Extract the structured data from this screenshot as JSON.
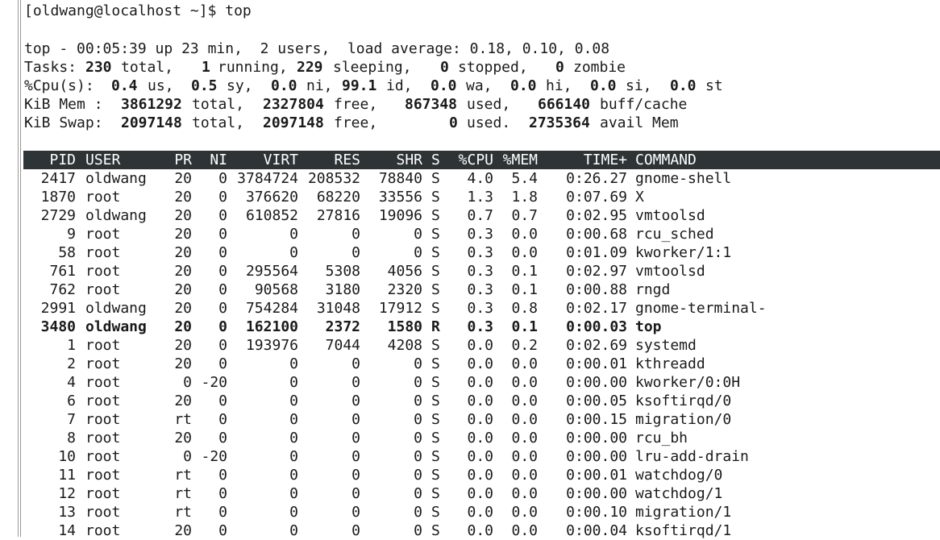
{
  "prompt": "[oldwang@localhost ~]$ top",
  "summary": {
    "line1": "top - 00:05:39 up 23 min,  2 users,  load average: 0.18, 0.10, 0.08",
    "tasks": {
      "label": "Tasks:",
      "total": "230",
      "total_l": "total,",
      "running": "1",
      "running_l": "running,",
      "sleeping": "229",
      "sleeping_l": "sleeping,",
      "stopped": "0",
      "stopped_l": "stopped,",
      "zombie": "0",
      "zombie_l": "zombie"
    },
    "cpu": {
      "label": "%Cpu(s):",
      "us": "0.4",
      "us_l": "us,",
      "sy": "0.5",
      "sy_l": "sy,",
      "ni": "0.0",
      "ni_l": "ni,",
      "id": "99.1",
      "id_l": "id,",
      "wa": "0.0",
      "wa_l": "wa,",
      "hi": "0.0",
      "hi_l": "hi,",
      "si": "0.0",
      "si_l": "si,",
      "st": "0.0",
      "st_l": "st"
    },
    "mem": {
      "label": "KiB Mem :",
      "total": "3861292",
      "total_l": "total,",
      "free": "2327804",
      "free_l": "free,",
      "used": "867348",
      "used_l": "used,",
      "buff": "666140",
      "buff_l": "buff/cache"
    },
    "swap": {
      "label": "KiB Swap:",
      "total": "2097148",
      "total_l": "total,",
      "free": "2097148",
      "free_l": "free,",
      "used": "0",
      "used_l": "used.",
      "avail": "2735364",
      "avail_l": "avail Mem"
    }
  },
  "columns": {
    "pid": "PID",
    "user": "USER",
    "pr": "PR",
    "ni": "NI",
    "virt": "VIRT",
    "res": "RES",
    "shr": "SHR",
    "s": "S",
    "cpu": "%CPU",
    "mem": "%MEM",
    "time": "TIME+",
    "command": "COMMAND"
  },
  "processes": [
    {
      "pid": "2417",
      "user": "oldwang",
      "pr": "20",
      "ni": "0",
      "virt": "3784724",
      "res": "208532",
      "shr": "78840",
      "s": "S",
      "cpu": "4.0",
      "mem": "5.4",
      "time": "0:26.27",
      "command": "gnome-shell"
    },
    {
      "pid": "1870",
      "user": "root",
      "pr": "20",
      "ni": "0",
      "virt": "376620",
      "res": "68220",
      "shr": "33556",
      "s": "S",
      "cpu": "1.3",
      "mem": "1.8",
      "time": "0:07.69",
      "command": "X"
    },
    {
      "pid": "2729",
      "user": "oldwang",
      "pr": "20",
      "ni": "0",
      "virt": "610852",
      "res": "27816",
      "shr": "19096",
      "s": "S",
      "cpu": "0.7",
      "mem": "0.7",
      "time": "0:02.95",
      "command": "vmtoolsd"
    },
    {
      "pid": "9",
      "user": "root",
      "pr": "20",
      "ni": "0",
      "virt": "0",
      "res": "0",
      "shr": "0",
      "s": "S",
      "cpu": "0.3",
      "mem": "0.0",
      "time": "0:00.68",
      "command": "rcu_sched"
    },
    {
      "pid": "58",
      "user": "root",
      "pr": "20",
      "ni": "0",
      "virt": "0",
      "res": "0",
      "shr": "0",
      "s": "S",
      "cpu": "0.3",
      "mem": "0.0",
      "time": "0:01.09",
      "command": "kworker/1:1"
    },
    {
      "pid": "761",
      "user": "root",
      "pr": "20",
      "ni": "0",
      "virt": "295564",
      "res": "5308",
      "shr": "4056",
      "s": "S",
      "cpu": "0.3",
      "mem": "0.1",
      "time": "0:02.97",
      "command": "vmtoolsd"
    },
    {
      "pid": "762",
      "user": "root",
      "pr": "20",
      "ni": "0",
      "virt": "90568",
      "res": "3180",
      "shr": "2320",
      "s": "S",
      "cpu": "0.3",
      "mem": "0.1",
      "time": "0:00.88",
      "command": "rngd"
    },
    {
      "pid": "2991",
      "user": "oldwang",
      "pr": "20",
      "ni": "0",
      "virt": "754284",
      "res": "31048",
      "shr": "17912",
      "s": "S",
      "cpu": "0.3",
      "mem": "0.8",
      "time": "0:02.17",
      "command": "gnome-terminal-"
    },
    {
      "pid": "3480",
      "user": "oldwang",
      "pr": "20",
      "ni": "0",
      "virt": "162100",
      "res": "2372",
      "shr": "1580",
      "s": "R",
      "cpu": "0.3",
      "mem": "0.1",
      "time": "0:00.03",
      "command": "top",
      "bold": true
    },
    {
      "pid": "1",
      "user": "root",
      "pr": "20",
      "ni": "0",
      "virt": "193976",
      "res": "7044",
      "shr": "4208",
      "s": "S",
      "cpu": "0.0",
      "mem": "0.2",
      "time": "0:02.69",
      "command": "systemd"
    },
    {
      "pid": "2",
      "user": "root",
      "pr": "20",
      "ni": "0",
      "virt": "0",
      "res": "0",
      "shr": "0",
      "s": "S",
      "cpu": "0.0",
      "mem": "0.0",
      "time": "0:00.01",
      "command": "kthreadd"
    },
    {
      "pid": "4",
      "user": "root",
      "pr": "0",
      "ni": "-20",
      "virt": "0",
      "res": "0",
      "shr": "0",
      "s": "S",
      "cpu": "0.0",
      "mem": "0.0",
      "time": "0:00.00",
      "command": "kworker/0:0H"
    },
    {
      "pid": "6",
      "user": "root",
      "pr": "20",
      "ni": "0",
      "virt": "0",
      "res": "0",
      "shr": "0",
      "s": "S",
      "cpu": "0.0",
      "mem": "0.0",
      "time": "0:00.05",
      "command": "ksoftirqd/0"
    },
    {
      "pid": "7",
      "user": "root",
      "pr": "rt",
      "ni": "0",
      "virt": "0",
      "res": "0",
      "shr": "0",
      "s": "S",
      "cpu": "0.0",
      "mem": "0.0",
      "time": "0:00.15",
      "command": "migration/0"
    },
    {
      "pid": "8",
      "user": "root",
      "pr": "20",
      "ni": "0",
      "virt": "0",
      "res": "0",
      "shr": "0",
      "s": "S",
      "cpu": "0.0",
      "mem": "0.0",
      "time": "0:00.00",
      "command": "rcu_bh"
    },
    {
      "pid": "10",
      "user": "root",
      "pr": "0",
      "ni": "-20",
      "virt": "0",
      "res": "0",
      "shr": "0",
      "s": "S",
      "cpu": "0.0",
      "mem": "0.0",
      "time": "0:00.00",
      "command": "lru-add-drain"
    },
    {
      "pid": "11",
      "user": "root",
      "pr": "rt",
      "ni": "0",
      "virt": "0",
      "res": "0",
      "shr": "0",
      "s": "S",
      "cpu": "0.0",
      "mem": "0.0",
      "time": "0:00.01",
      "command": "watchdog/0"
    },
    {
      "pid": "12",
      "user": "root",
      "pr": "rt",
      "ni": "0",
      "virt": "0",
      "res": "0",
      "shr": "0",
      "s": "S",
      "cpu": "0.0",
      "mem": "0.0",
      "time": "0:00.00",
      "command": "watchdog/1"
    },
    {
      "pid": "13",
      "user": "root",
      "pr": "rt",
      "ni": "0",
      "virt": "0",
      "res": "0",
      "shr": "0",
      "s": "S",
      "cpu": "0.0",
      "mem": "0.0",
      "time": "0:00.10",
      "command": "migration/1"
    },
    {
      "pid": "14",
      "user": "root",
      "pr": "20",
      "ni": "0",
      "virt": "0",
      "res": "0",
      "shr": "0",
      "s": "S",
      "cpu": "0.0",
      "mem": "0.0",
      "time": "0:00.04",
      "command": "ksoftirqd/1"
    }
  ]
}
